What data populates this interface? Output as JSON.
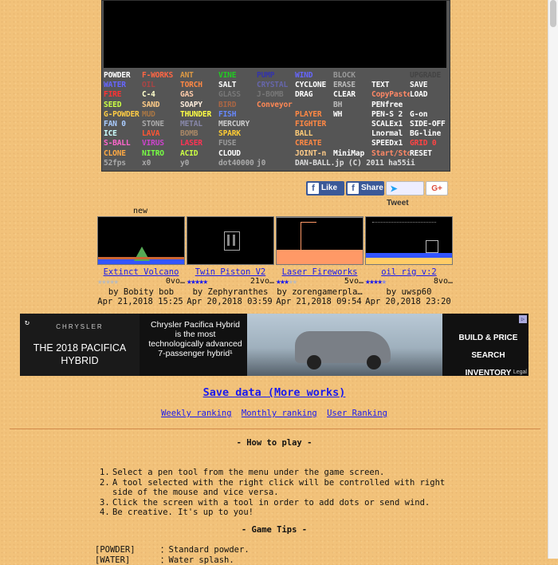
{
  "menu": {
    "rows": [
      [
        [
          "POWDER",
          "#ffffff"
        ],
        [
          "F-WORKS",
          "#ff6644"
        ],
        [
          "ANT",
          "#dd9944"
        ],
        [
          "VINE",
          "#22cc22"
        ],
        [
          "PUMP",
          "#3333aa"
        ],
        [
          "WIND",
          "#6666ff"
        ],
        [
          "BLOCK",
          "#999999"
        ],
        [
          "",
          ""
        ],
        [
          "UPGRADE",
          "#444444"
        ]
      ],
      [
        [
          "WATER",
          "#6666ff"
        ],
        [
          "OIL",
          "#aa4444"
        ],
        [
          "TORCH",
          "#ff8844"
        ],
        [
          "SALT",
          "#ffffff"
        ],
        [
          "CRYSTAL",
          "#6666aa"
        ],
        [
          "CYCLONE",
          "#ffffff"
        ],
        [
          "ERASE",
          "#bbbbbb"
        ],
        [
          "TEXT",
          "#ffffff"
        ],
        [
          "SAVE",
          "#ffffff"
        ]
      ],
      [
        [
          "FIRE",
          "#ff3333"
        ],
        [
          "C-4",
          "#ffffcc"
        ],
        [
          "GAS",
          "#ffccaa"
        ],
        [
          "GLASS",
          "#777777"
        ],
        [
          "J-BOMB",
          "#777777"
        ],
        [
          "DRAG",
          "#ffffff"
        ],
        [
          "CLEAR",
          "#ffffff"
        ],
        [
          "CopyPaste",
          "#ff8866"
        ],
        [
          "LOAD",
          "#ffffff"
        ]
      ],
      [
        [
          "SEED",
          "#ccff44"
        ],
        [
          "SAND",
          "#ffcc88"
        ],
        [
          "SOAPY",
          "#ffeedd"
        ],
        [
          "BIRD",
          "#aa6644"
        ],
        [
          "Conveyor",
          "#ff8855"
        ],
        [
          "",
          ""
        ],
        [
          "BH",
          "#bbbbbb"
        ],
        [
          "PENfree",
          "#ffffff"
        ],
        [
          "",
          ""
        ]
      ],
      [
        [
          "G-POWDER",
          "#ffcc44"
        ],
        [
          "MUD",
          "#aa7744"
        ],
        [
          "THUNDER",
          "#ffff44"
        ],
        [
          "FISH",
          "#6688ff"
        ],
        [
          "",
          ""
        ],
        [
          "PLAYER",
          "#ff8844"
        ],
        [
          "WH",
          "#ffffff"
        ],
        [
          "PEN-S 2",
          "#ffffff"
        ],
        [
          "G-on",
          "#ffffff"
        ]
      ],
      [
        [
          "FAN 0",
          "#aaccff"
        ],
        [
          "STONE",
          "#aaaaaa"
        ],
        [
          "METAL",
          "#8888aa"
        ],
        [
          "MERCURY",
          "#cccccc"
        ],
        [
          "",
          ""
        ],
        [
          "FIGHTER",
          "#ff8844"
        ],
        [
          "",
          ""
        ],
        [
          "SCALEx1",
          "#ffffff"
        ],
        [
          "SIDE-OFF",
          "#ffffff"
        ]
      ],
      [
        [
          "ICE",
          "#ccffff"
        ],
        [
          "LAVA",
          "#ff5533"
        ],
        [
          "BOMB",
          "#aa8866"
        ],
        [
          "SPARK",
          "#ffcc33"
        ],
        [
          "",
          ""
        ],
        [
          "BALL",
          "#ffcc77"
        ],
        [
          "",
          ""
        ],
        [
          "Lnormal",
          "#ffffff"
        ],
        [
          "BG-line",
          "#ffffff"
        ]
      ],
      [
        [
          "S-BALL",
          "#ff66cc"
        ],
        [
          "VIRUS",
          "#cc44cc"
        ],
        [
          "LASER",
          "#ff3355"
        ],
        [
          "FUSE",
          "#999999"
        ],
        [
          "",
          ""
        ],
        [
          "CREATE",
          "#ff8844"
        ],
        [
          "",
          ""
        ],
        [
          "SPEEDx1",
          "#ffffff"
        ],
        [
          "GRID 0",
          "#ff4444"
        ]
      ],
      [
        [
          "CLONE",
          "#ffaa44"
        ],
        [
          "NITRO",
          "#77ff44"
        ],
        [
          "ACID",
          "#ccff44"
        ],
        [
          "CLOUD",
          "#ffffff"
        ],
        [
          "",
          ""
        ],
        [
          "JOINT-n",
          "#ffcc88"
        ],
        [
          "MiniMap",
          "#ffffff"
        ],
        [
          "Start/Stop",
          "#ff8866"
        ],
        [
          "RESET",
          "#ffffff"
        ]
      ],
      [
        [
          "52fps",
          "#aaaaaa"
        ],
        [
          "x0",
          "#aaaaaa"
        ],
        [
          "y0",
          "#aaaaaa"
        ],
        [
          "dot40000",
          "#aaaaaa"
        ],
        [
          "j0",
          "#aaaaaa"
        ],
        [
          "DAN-BALL.jp (C) 2011 ha55ii",
          "#dddddd"
        ]
      ]
    ]
  },
  "social": {
    "like": "Like",
    "share": "Share",
    "tweet": "Tweet",
    "gplus": "G+"
  },
  "works": {
    "new_label": "new",
    "items": [
      {
        "title": "Extinct Volcano",
        "rating": 0,
        "votes": "0vo…",
        "author": "by Bobity bob",
        "date": "Apr 21,2018 15:25"
      },
      {
        "title": "Twin Piston V2",
        "rating": 5,
        "votes": "21vo…",
        "author": "by Zephyranthes",
        "date": "Apr 20,2018 03:59"
      },
      {
        "title": "Laser Fireworks",
        "rating": 3,
        "votes": "5vo…",
        "author": "by zorengamerpla…",
        "date": "Apr 21,2018 09:54"
      },
      {
        "title": "oil rig v:2",
        "rating": 4.5,
        "votes": "8vo…",
        "author": "by uwsp60",
        "date": "Apr 20,2018 23:20"
      }
    ]
  },
  "ad": {
    "brand": "CHRYSLER",
    "headline": "THE 2018 PACIFICA HYBRID",
    "body": "Chrysler Pacifica Hybrid is the most technologically advanced 7-passenger hybrid¹",
    "cta1": "BUILD & PRICE",
    "cta2": "SEARCH INVENTORY",
    "legal": "Legal"
  },
  "links": {
    "save_data": "Save data (More works)",
    "weekly": "Weekly ranking",
    "monthly": "Monthly ranking",
    "user": "User Ranking"
  },
  "howto": {
    "title": "- How to play -",
    "items": [
      "Select a pen tool from the menu under the game screen.",
      "A tool selected with the right click will be controlled with right side of the mouse and vice versa.",
      "Click the screen with a tool in order to add dots or send wind.",
      "Be creative. It's up to you!"
    ]
  },
  "tips": {
    "title": "- Game Tips -",
    "items": [
      {
        "key": "[POWDER]",
        "desc": "：Standard powder."
      },
      {
        "key": "[WATER]",
        "desc": "：Water splash."
      }
    ]
  }
}
